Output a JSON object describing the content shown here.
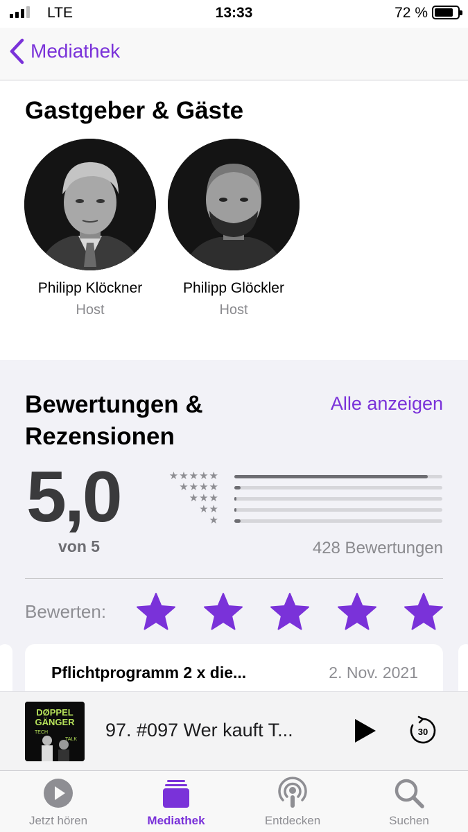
{
  "status_bar": {
    "carrier": "LTE",
    "time": "13:33",
    "battery": "72 %"
  },
  "nav": {
    "back_label": "Mediathek"
  },
  "hosts": {
    "title": "Gastgeber & Gäste",
    "people": [
      {
        "name": "Philipp Klöckner",
        "role": "Host"
      },
      {
        "name": "Philipp Glöckler",
        "role": "Host"
      }
    ]
  },
  "ratings": {
    "title_line1": "Bewertungen &",
    "title_line2": "Rezensionen",
    "see_all": "Alle anzeigen",
    "score": "5,0",
    "out_of": "von 5",
    "count": "428 Bewertungen",
    "distribution": [
      {
        "stars": 5,
        "fraction": 0.93
      },
      {
        "stars": 4,
        "fraction": 0.03
      },
      {
        "stars": 3,
        "fraction": 0.01
      },
      {
        "stars": 2,
        "fraction": 0.01
      },
      {
        "stars": 1,
        "fraction": 0.03
      }
    ],
    "rate_label": "Bewerten:",
    "rate_star_count": 5,
    "accent_color": "#7a32d9"
  },
  "review": {
    "title": "Pflichtprogramm 2 x die...",
    "date": "2. Nov. 2021"
  },
  "player": {
    "episode_title": "97. #097 Wer kauft T...",
    "skip_seconds": "30",
    "artwork_text": {
      "line1": "DØPPEL",
      "line2": "GÄNGER",
      "line3": "TECH",
      "line4": "TALK"
    }
  },
  "tabbar": {
    "tabs": [
      {
        "label": "Jetzt hören",
        "icon": "play-circle-icon",
        "active": false
      },
      {
        "label": "Mediathek",
        "icon": "library-stack-icon",
        "active": true
      },
      {
        "label": "Entdecken",
        "icon": "podcast-antenna-icon",
        "active": false
      },
      {
        "label": "Suchen",
        "icon": "search-icon",
        "active": false
      }
    ]
  }
}
